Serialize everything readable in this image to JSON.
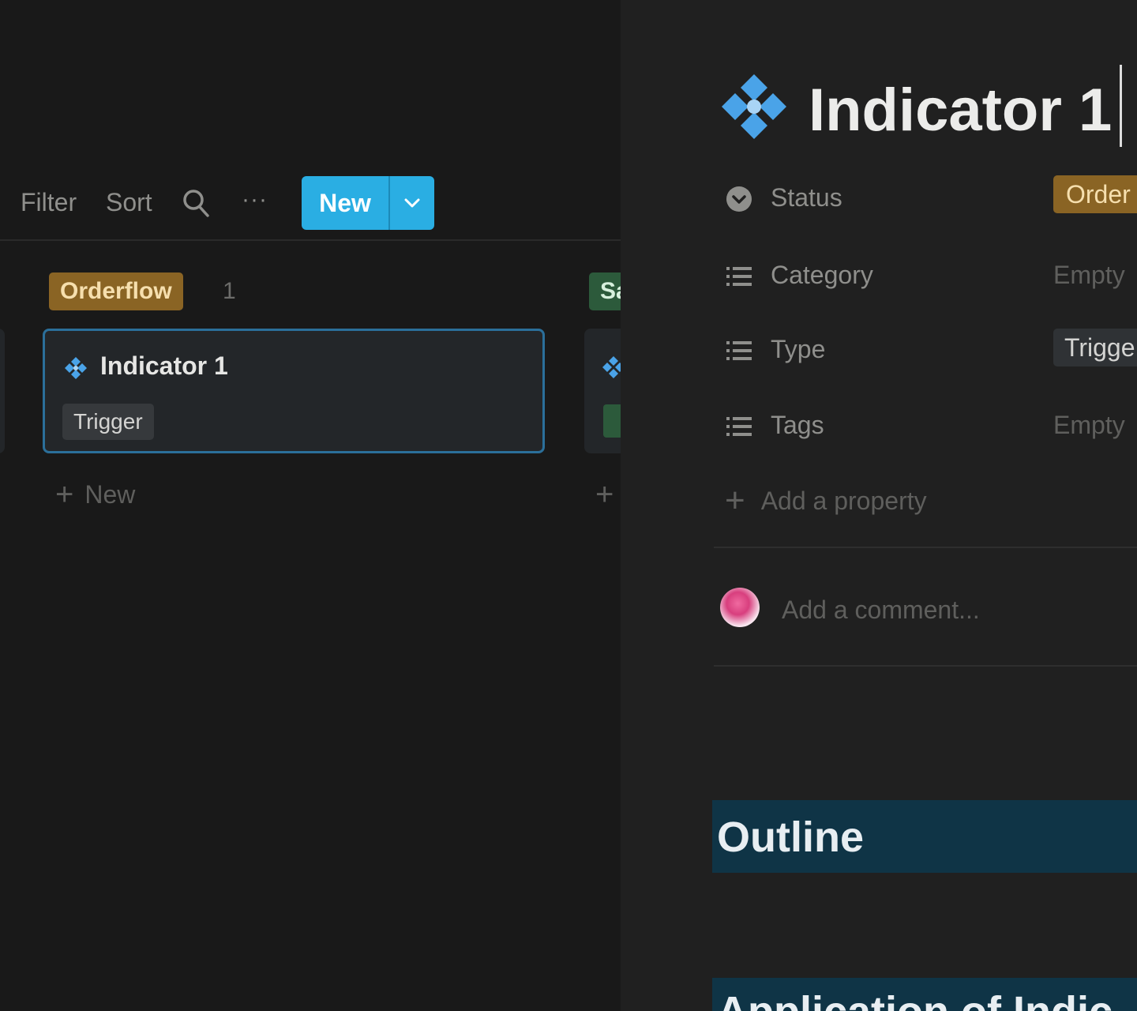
{
  "toolbar": {
    "filter_label": "Filter",
    "sort_label": "Sort",
    "more_label": "···",
    "search_icon": "search-icon",
    "new_label": "New",
    "new_dropdown_icon": "chevron-down-icon",
    "accent_color": "#2aaee3"
  },
  "board": {
    "group": {
      "label": "Orderflow",
      "count": "1",
      "color": "#8a6424"
    },
    "next_group": {
      "label": "Sa",
      "color": "#2c5a3b"
    },
    "card": {
      "title": "Indicator 1",
      "tag": "Trigger",
      "icon": "diamond-icon"
    },
    "add_new_label": "New",
    "add_icon": "plus-icon"
  },
  "page": {
    "title": "Indicator 1",
    "icon": "diamond-icon",
    "properties": [
      {
        "label": "Status",
        "icon": "status-icon",
        "value": "Order",
        "style": "pill-orange"
      },
      {
        "label": "Category",
        "icon": "list-icon",
        "value": "Empty",
        "style": "empty"
      },
      {
        "label": "Type",
        "icon": "list-icon",
        "value": "Trigge",
        "style": "pill-gray"
      },
      {
        "label": "Tags",
        "icon": "list-icon",
        "value": "Empty",
        "style": "empty"
      }
    ],
    "add_property_label": "Add a property",
    "comment_placeholder": "Add a comment...",
    "headings": [
      "Outline",
      "Application of Indic"
    ]
  }
}
